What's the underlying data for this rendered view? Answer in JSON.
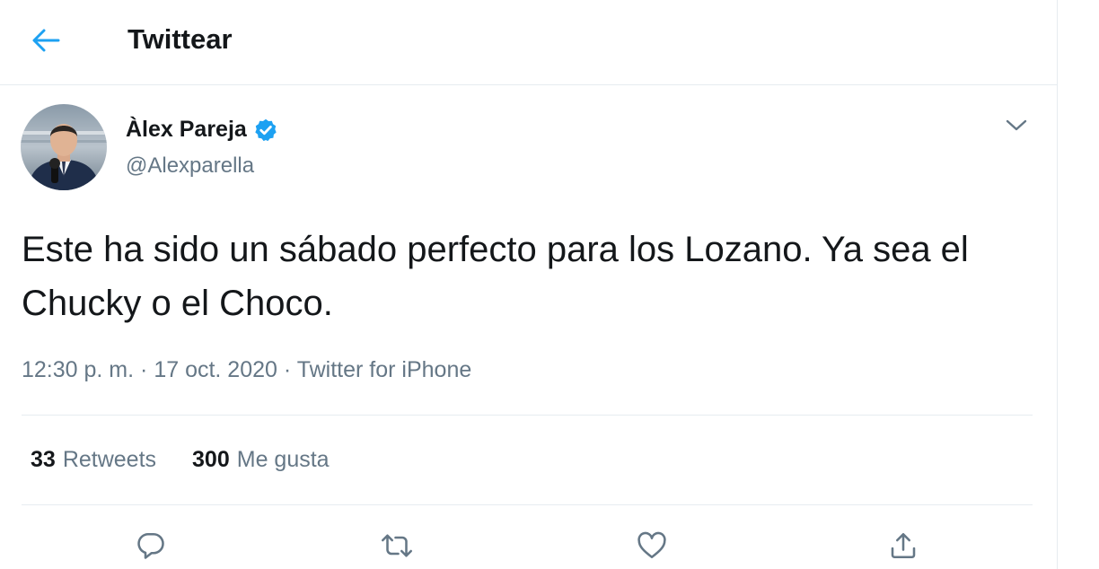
{
  "header": {
    "title": "Twittear",
    "back_icon": "back-arrow-icon",
    "accent_color": "#1da1f2"
  },
  "tweet": {
    "author_name": "Àlex Pareja",
    "verified_icon": "verified-badge-icon",
    "handle": "@Alexparella",
    "text": "Este ha sido un sábado perfecto para los Lozano. Ya sea el Chucky o el Choco.",
    "time": "12:30 p. m.",
    "date": "17 oct. 2020",
    "source": "Twitter for iPhone",
    "separator": "·"
  },
  "stats": {
    "retweets_count": "33",
    "retweets_label": "Retweets",
    "likes_count": "300",
    "likes_label": "Me gusta"
  },
  "actions": {
    "reply_icon": "reply-icon",
    "retweet_icon": "retweet-icon",
    "like_icon": "heart-icon",
    "share_icon": "share-icon",
    "icon_color": "#657786"
  }
}
